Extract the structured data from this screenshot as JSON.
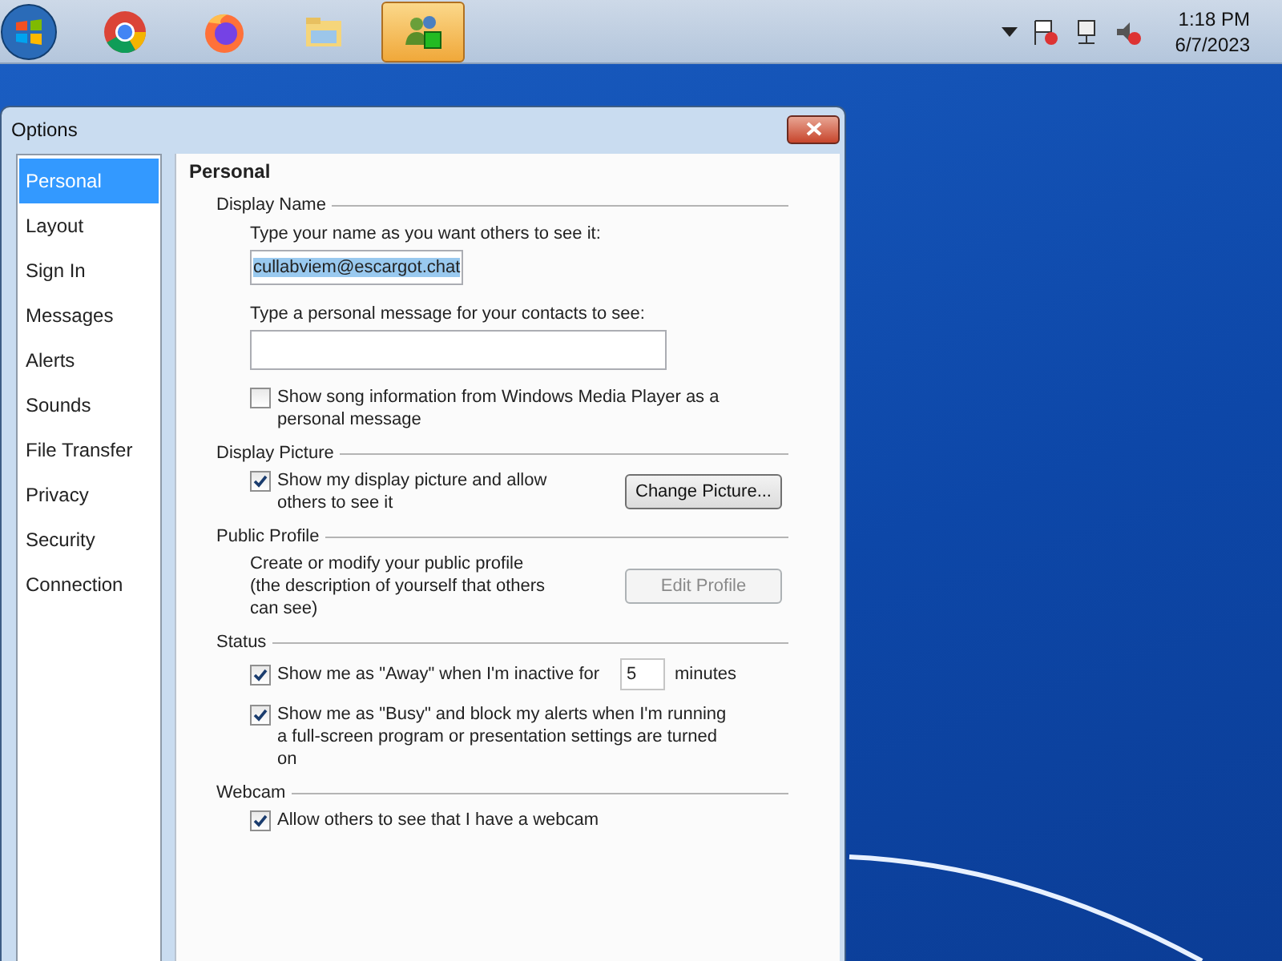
{
  "taskbar": {
    "apps": [
      {
        "kind": "chrome",
        "selected": false
      },
      {
        "kind": "firefox",
        "selected": false
      },
      {
        "kind": "folder",
        "selected": false
      },
      {
        "kind": "messenger",
        "selected": true
      }
    ],
    "clock": {
      "time": "1:18 PM",
      "date": "6/7/2023"
    }
  },
  "window": {
    "title": "Options"
  },
  "sidebar": {
    "items": [
      {
        "label": "Personal",
        "selected": true
      },
      {
        "label": "Layout",
        "selected": false
      },
      {
        "label": "Sign In",
        "selected": false
      },
      {
        "label": "Messages",
        "selected": false
      },
      {
        "label": "Alerts",
        "selected": false
      },
      {
        "label": "Sounds",
        "selected": false
      },
      {
        "label": "File Transfer",
        "selected": false
      },
      {
        "label": "Privacy",
        "selected": false
      },
      {
        "label": "Security",
        "selected": false
      },
      {
        "label": "Connection",
        "selected": false
      }
    ]
  },
  "panel": {
    "heading": "Personal",
    "display_name": {
      "title": "Display Name",
      "name_label": "Type your name as you want others to see it:",
      "name_value": "cullabviem@escargot.chat",
      "message_label": "Type a personal message for your contacts to see:",
      "song_option": {
        "label": "Show song information from Windows Media Player as a personal message",
        "checked": false
      }
    },
    "display_picture": {
      "title": "Display Picture",
      "option": {
        "label": "Show my display picture and allow others to see it",
        "checked": true
      },
      "button": "Change Picture..."
    },
    "public_profile": {
      "title": "Public Profile",
      "description": "Create or modify your public profile (the description of yourself that others can see)",
      "button": {
        "label": "Edit Profile",
        "disabled": true
      }
    },
    "status": {
      "title": "Status",
      "away": {
        "label": "Show me as \"Away\" when I'm inactive for",
        "checked": true,
        "minutes": "5",
        "unit": "minutes"
      },
      "busy": {
        "label": "Show me as \"Busy\" and block my alerts when I'm running a full-screen program or presentation settings are turned on",
        "checked": true
      }
    },
    "webcam": {
      "title": "Webcam",
      "option": {
        "label": "Allow others to see that I have a webcam",
        "checked": true
      }
    }
  }
}
